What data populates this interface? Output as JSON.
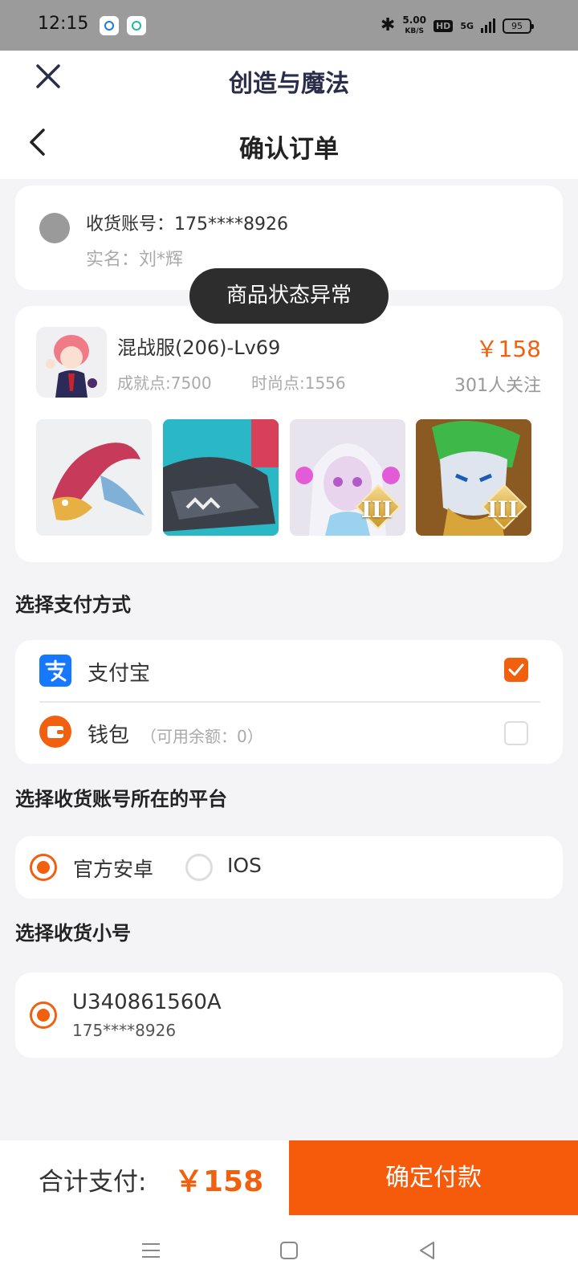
{
  "status_bar": {
    "time": "12:15",
    "speed": "5.00",
    "speed_unit": "KB/S",
    "hd": "HD",
    "network": "5G",
    "battery": "95"
  },
  "header": {
    "app_title": "创造与魔法",
    "page_title": "确认订单"
  },
  "address": {
    "account_line": "收货账号：175****8926",
    "name_line": "实名：刘*辉"
  },
  "toast": "商品状态异常",
  "product": {
    "name": "混战服(206)-Lv69",
    "price": "￥158",
    "achievement": "成就点:7500",
    "fashion": "时尚点:1556",
    "followers": "301人关注",
    "skins": [
      {
        "name": "dragon",
        "rank": ""
      },
      {
        "name": "mech-beast",
        "rank": ""
      },
      {
        "name": "spirit-girl",
        "rank": "III"
      },
      {
        "name": "lion-warrior",
        "rank": "III"
      }
    ]
  },
  "payment": {
    "section_title": "选择支付方式",
    "options": [
      {
        "label": "支付宝",
        "sub": "",
        "icon": "alipay-icon",
        "checked": true,
        "color": "#1677ff"
      },
      {
        "label": "钱包",
        "sub": "（可用余额：0）",
        "icon": "wallet-icon",
        "checked": false,
        "color": "#f0600e"
      }
    ]
  },
  "platform": {
    "section_title": "选择收货账号所在的平台",
    "options": [
      {
        "label": "官方安卓",
        "selected": true
      },
      {
        "label": "IOS",
        "selected": false
      }
    ]
  },
  "account": {
    "section_title": "选择收货小号",
    "id": "U340861560A",
    "phone": "175****8926",
    "selected": true
  },
  "footer": {
    "total_label": "合计支付:",
    "total_value": "￥158",
    "confirm_label": "确定付款"
  },
  "colors": {
    "accent": "#f0600e",
    "header_text": "#2a2e4a",
    "alipay": "#1677ff"
  }
}
